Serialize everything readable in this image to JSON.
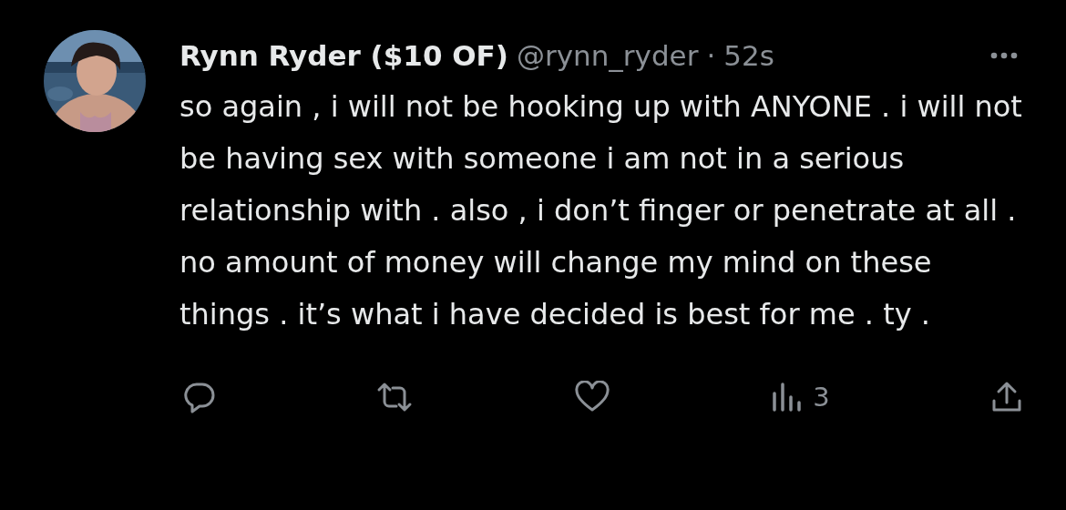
{
  "tweet": {
    "author": {
      "name": "Rynn Ryder ($10 OF)",
      "handle": "@rynn_ryder",
      "separator": "·",
      "time": "52s"
    },
    "text": "so again , i will not be hooking up with ANYONE . i will not be having sex with someone i am not in a serious relationship with . also , i don’t finger or penetrate at all . no amount of money will change my mind on these things . it’s what i have decided is best for me . ty .",
    "actions": [
      {
        "kind": "reply"
      },
      {
        "kind": "retweet"
      },
      {
        "kind": "like"
      },
      {
        "kind": "views",
        "count": "3"
      },
      {
        "kind": "share"
      }
    ]
  }
}
